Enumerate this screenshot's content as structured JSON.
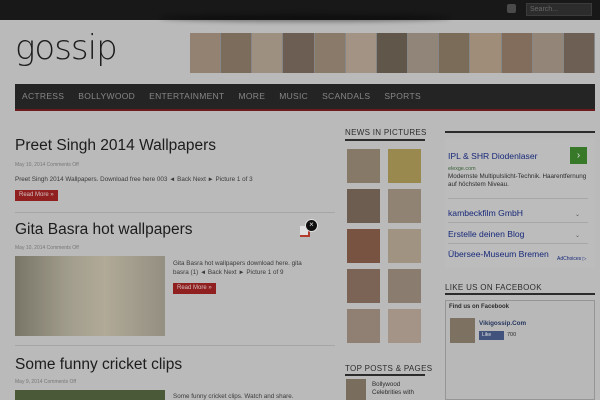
{
  "header": {
    "logo": "gossip",
    "search_placeholder": "Search..."
  },
  "nav": {
    "items": [
      "ACTRESS",
      "BOLLYWOOD",
      "ENTERTAINMENT",
      "MORE",
      "MUSIC",
      "SCANDALS",
      "SPORTS"
    ]
  },
  "posts": [
    {
      "title": "Preet Singh 2014 Wallpapers",
      "meta": "May 10, 2014  Comments Off",
      "excerpt": "Preet Singh 2014 Wallpapers. Download free here 003 ◄ Back Next ► Picture 1 of 3",
      "read_more": "Read More »"
    },
    {
      "title": "Gita Basra hot wallpapers",
      "meta": "May 10, 2014  Comments Off",
      "excerpt": "Gita Basra hot wallpapers download here. gita basra (1) ◄ Back Next ► Picture 1 of 9",
      "read_more": "Read More »"
    },
    {
      "title": "Some funny cricket clips",
      "meta": "May 9, 2014  Comments Off",
      "excerpt": "Some funny cricket clips. Watch and share."
    }
  ],
  "sidebar": {
    "news_pictures_heading": "NEWS IN PICTURES",
    "top_posts_heading": "TOP POSTS & PAGES",
    "top_post_1": "Bollywood Celebrities with"
  },
  "ads": {
    "ad1_title": "IPL & SHR Diodenlaser",
    "ad1_url": "elexge.com",
    "ad1_desc": "Modernste Multipulslicht-Technik. Haarentfernung auf höchstem Niveau.",
    "ad2_title": "kambeckfilm GmbH",
    "ad3_title": "Erstelle deinen Blog",
    "ad4_title": "Übersee-Museum Bremen",
    "adchoices": "AdChoices ▷"
  },
  "facebook": {
    "heading": "LIKE US ON FACEBOOK",
    "box_title": "Find us on Facebook",
    "page_name": "Vikigossip.Com",
    "like_label": "Like",
    "like_count": "700"
  },
  "popup": {
    "close_symbol": "×"
  }
}
